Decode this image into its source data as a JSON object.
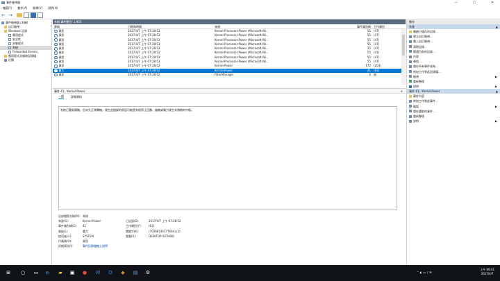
{
  "window": {
    "title": "事件檢視器",
    "min": "—",
    "max": "☐",
    "close": "✕"
  },
  "menu": [
    "檔案(F)",
    "動作(A)",
    "檢視(V)",
    "說明(H)"
  ],
  "tree": {
    "root": "事件檢視器 (本機)",
    "custom_views": "自訂檢視",
    "windows_logs": "Windows 記錄",
    "logs": [
      "應用程式",
      "安全性",
      "安裝程式",
      "系統",
      "Forwarded Events"
    ],
    "apps_services": "應用程式及服務記錄檔",
    "subscriptions": "訂閱"
  },
  "list": {
    "header": "系統    事件數目: 1,955",
    "columns": [
      "層級",
      "日期和時間",
      "來源",
      "事件識別碼",
      "工作類別"
    ],
    "rows": [
      {
        "level": "資訊",
        "time": "2017/4/7 上午 07:28:53",
        "source": "Kernel-Processor-Power (Microsoft-Wi...",
        "id": "55",
        "task": "(47)"
      },
      {
        "level": "資訊",
        "time": "2017/4/7 上午 07:28:53",
        "source": "Kernel-Processor-Power (Microsoft-Wi...",
        "id": "55",
        "task": "(47)"
      },
      {
        "level": "資訊",
        "time": "2017/4/7 上午 07:28:53",
        "source": "Kernel-Processor-Power (Microsoft-Wi...",
        "id": "55",
        "task": "(47)"
      },
      {
        "level": "資訊",
        "time": "2017/4/7 上午 07:28:53",
        "source": "Kernel-Processor-Power (Microsoft-Wi...",
        "id": "55",
        "task": "(47)"
      },
      {
        "level": "資訊",
        "time": "2017/4/7 上午 07:28:53",
        "source": "Kernel-Processor-Power (Microsoft-Wi...",
        "id": "55",
        "task": "(47)"
      },
      {
        "level": "資訊",
        "time": "2017/4/7 上午 07:28:53",
        "source": "Kernel-Processor-Power (Microsoft-Wi...",
        "id": "55",
        "task": "(47)"
      },
      {
        "level": "資訊",
        "time": "2017/4/7 上午 07:28:53",
        "source": "Kernel-Processor-Power (Microsoft-Wi...",
        "id": "55",
        "task": "(47)"
      },
      {
        "level": "資訊",
        "time": "2017/4/7 上午 07:28:53",
        "source": "Kernel-Processor-Power (Microsoft-Wi...",
        "id": "55",
        "task": "(47)"
      },
      {
        "level": "資訊",
        "time": "2017/4/7 上午 07:28:52",
        "source": "Kernel-Power",
        "id": "172",
        "task": "(203)"
      },
      {
        "level": "重大",
        "time": "2017/4/7 上午 07:28:52",
        "source": "Kernel-Power",
        "id": "41",
        "task": "(63)",
        "selected": true
      },
      {
        "level": "資訊",
        "time": "2017/4/7 上午 07:28:52",
        "source": "FilterManager",
        "id": "6",
        "task": "無"
      }
    ]
  },
  "detail": {
    "header": "事件 41，Kernel-Power",
    "close": "✕",
    "tabs": [
      "一般",
      "詳細資料"
    ],
    "message": "系統已重新開機，但未先正常關機。發生此錯誤的原因可能是系統停止回應、當機或電力發生非預期的中斷。",
    "props": {
      "log_name_label": "記錄檔案名稱(M):",
      "log_name": "系統",
      "source_label": "來源(S):",
      "source": "Kernel-Power",
      "logged_label": "已記錄(D):",
      "logged": "2017/4/7 上午 07:28:52",
      "event_id_label": "事件識別碼(E):",
      "event_id": "41",
      "task_label": "工作類別(Y):",
      "task": "(63)",
      "level_label": "層級(L):",
      "level": "重大",
      "keywords_label": "關鍵字(K):",
      "keywords": "(70368744177664),(2)",
      "user_label": "使用者(U):",
      "user": "SYSTEM",
      "computer_label": "電腦(R):",
      "computer": "DESKTOP-5STH6KI",
      "opcode_label": "作業碼(O):",
      "opcode": "資訊",
      "more_label": "詳細資訊(I):",
      "more_link": "事件記錄檔線上說明"
    }
  },
  "actions": {
    "header": "動作",
    "section1": "系統",
    "items1": [
      "開啟已儲存的記錄...",
      "建立自訂檢視...",
      "匯入自訂檢視...",
      "清除記錄...",
      "篩選目前的記錄...",
      "內容",
      "尋找...",
      "儲存所有事件成為...",
      "附加工作到此記錄檔...",
      "檢視",
      "重新整理",
      "說明"
    ],
    "section2": "事件 41，Kernel-Power",
    "items2": [
      "事件內容",
      "附加工作到此事件...",
      "複製",
      "儲存選取的事件...",
      "重新整理",
      "說明"
    ]
  },
  "taskbar": {
    "time": "上午 09:41",
    "date": "2017/4/7"
  },
  "colors": {
    "selection": "#0078d7",
    "pane_header": "#5a6b80",
    "taskbar": "#101418",
    "action_section": "#c9d9ec"
  }
}
